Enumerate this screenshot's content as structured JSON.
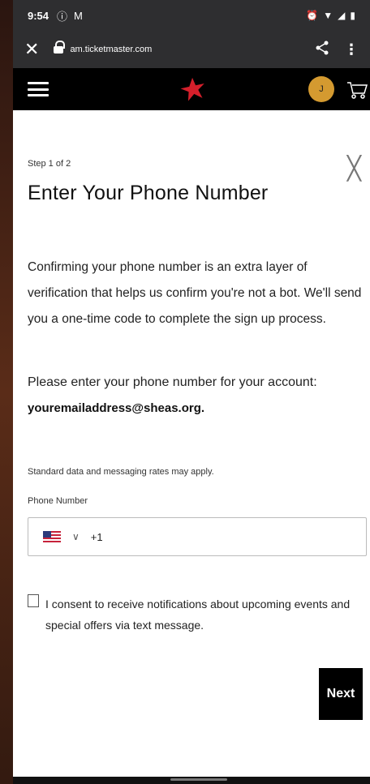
{
  "status_bar": {
    "time": "9:54",
    "left_icons": [
      "info-icon",
      "gmail-icon"
    ],
    "right_icons": [
      "alarm-icon",
      "wifi-icon",
      "signal-icon",
      "battery-icon"
    ]
  },
  "browser": {
    "url": "am.ticketmaster.com"
  },
  "site_nav": {
    "avatar_initial": "J",
    "brand_color": "#d51f2b"
  },
  "form": {
    "step": "Step 1 of 2",
    "title": "Enter Your Phone Number",
    "description": "Confirming your phone number is an extra layer of verification that helps us confirm you're not a bot. We'll send you a one-time code to complete the sign up process.",
    "prompt": "Please enter your phone number for your account:",
    "email": "youremailaddress@sheas.org.",
    "rates_note": "Standard data and messaging rates may apply.",
    "phone_label": "Phone Number",
    "country_code": "+1",
    "consent_text": "I consent to receive notifications about upcoming events and special offers via text message.",
    "next_label": "Next"
  }
}
